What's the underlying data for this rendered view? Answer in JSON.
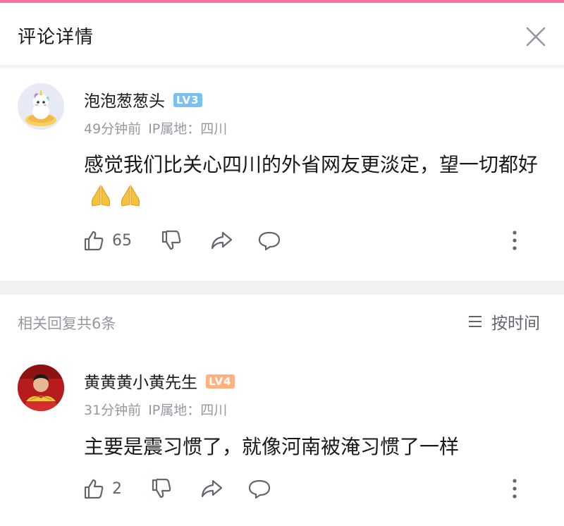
{
  "header": {
    "title": "评论详情"
  },
  "main_comment": {
    "username": "泡泡葱葱头",
    "level": "LV3",
    "time": "49分钟前",
    "ip": "IP属地：四川",
    "text": "感觉我们比关心四川的外省网友更淡定，望一切都好",
    "likes": "65"
  },
  "replies_header": {
    "count_label": "相关回复共6条",
    "sort_label": "按时间"
  },
  "reply": {
    "username": "黄黄黄小黄先生",
    "level": "LV4",
    "time": "31分钟前",
    "ip": "IP属地：四川",
    "text": "主要是震习惯了，就像河南被淹习惯了一样",
    "likes": "2"
  },
  "colors": {
    "accent": "#fb7299",
    "lv3": "#7bc0f3",
    "lv4": "#ffb27f",
    "text_primary": "#18191c",
    "text_secondary": "#9499a0",
    "icon": "#61666d"
  },
  "icons": [
    "close-icon",
    "like-icon",
    "dislike-icon",
    "share-icon",
    "comment-icon",
    "more-icon",
    "sort-icon",
    "pray-emoji"
  ]
}
